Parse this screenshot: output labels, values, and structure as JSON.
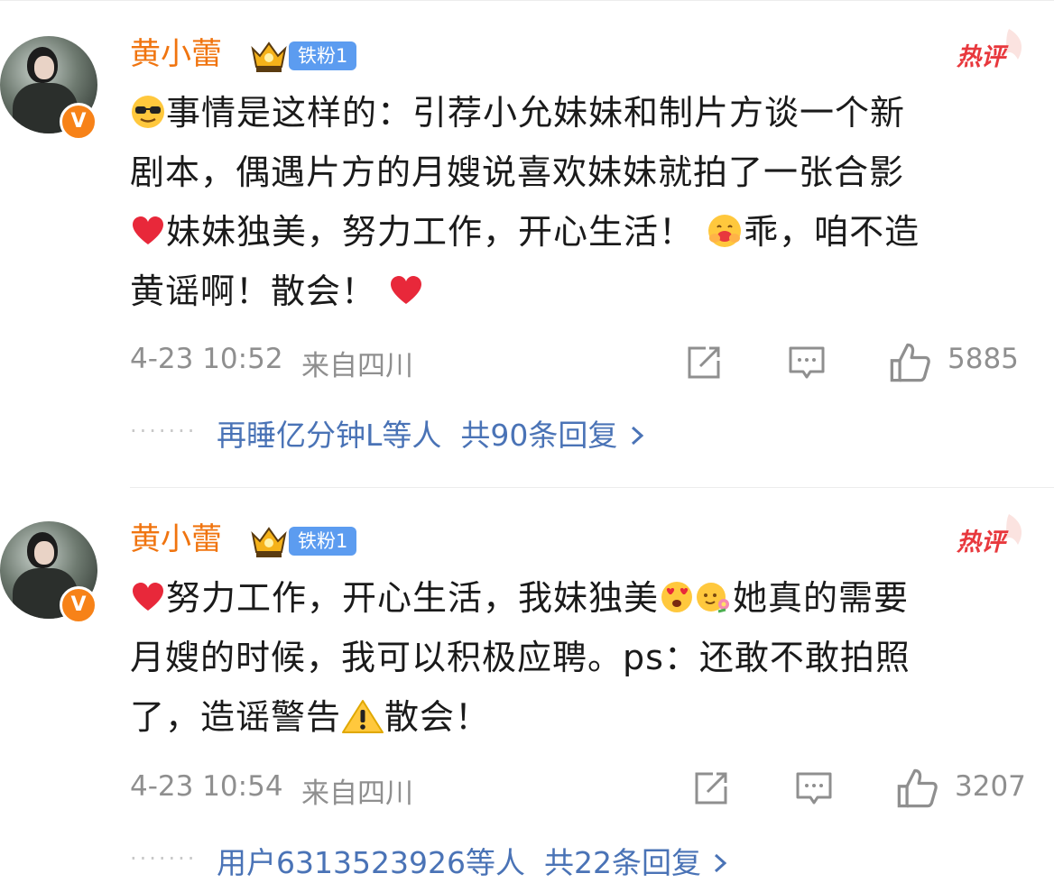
{
  "comments": [
    {
      "name": "黄小蕾",
      "fan_label": "铁粉1",
      "hot_label": "热评",
      "text_lines": [
        "事情是这样的：引荐小允妹妹和制片方谈一个新",
        "剧本，偶遇片方的月嫂说喜欢妹妹就拍了一张合影",
        "妹妹独美，努力工作，开心生活！",
        "乖，咱不造",
        "黄谣啊！散会！"
      ],
      "time": "4-23 10:52",
      "location": "来自四川",
      "likes": "5885",
      "reply_users": "再睡亿分钟L等人",
      "reply_count": "共90条回复"
    },
    {
      "name": "黄小蕾",
      "fan_label": "铁粉1",
      "hot_label": "热评",
      "text_lines": [
        "努力工作，开心生活，我妹独美",
        "她真的需要",
        "月嫂的时候，我可以积极应聘。ps：还敢不敢拍照",
        "了，造谣警告",
        "散会！"
      ],
      "time": "4-23 10:54",
      "location": "来自四川",
      "likes": "3207",
      "reply_users": "用户6313523926等人",
      "reply_count": "共22条回复"
    }
  ],
  "icons": {
    "repost": "share-icon",
    "comment": "comment-icon",
    "like": "thumbs-up-icon",
    "chevron": "chevron-right-icon"
  },
  "colors": {
    "name": "#f0740f",
    "reply_link": "#4a73b6",
    "meta": "#8f8f8f",
    "fan_badge": "#5c9cf0",
    "verified": "#f78218"
  }
}
